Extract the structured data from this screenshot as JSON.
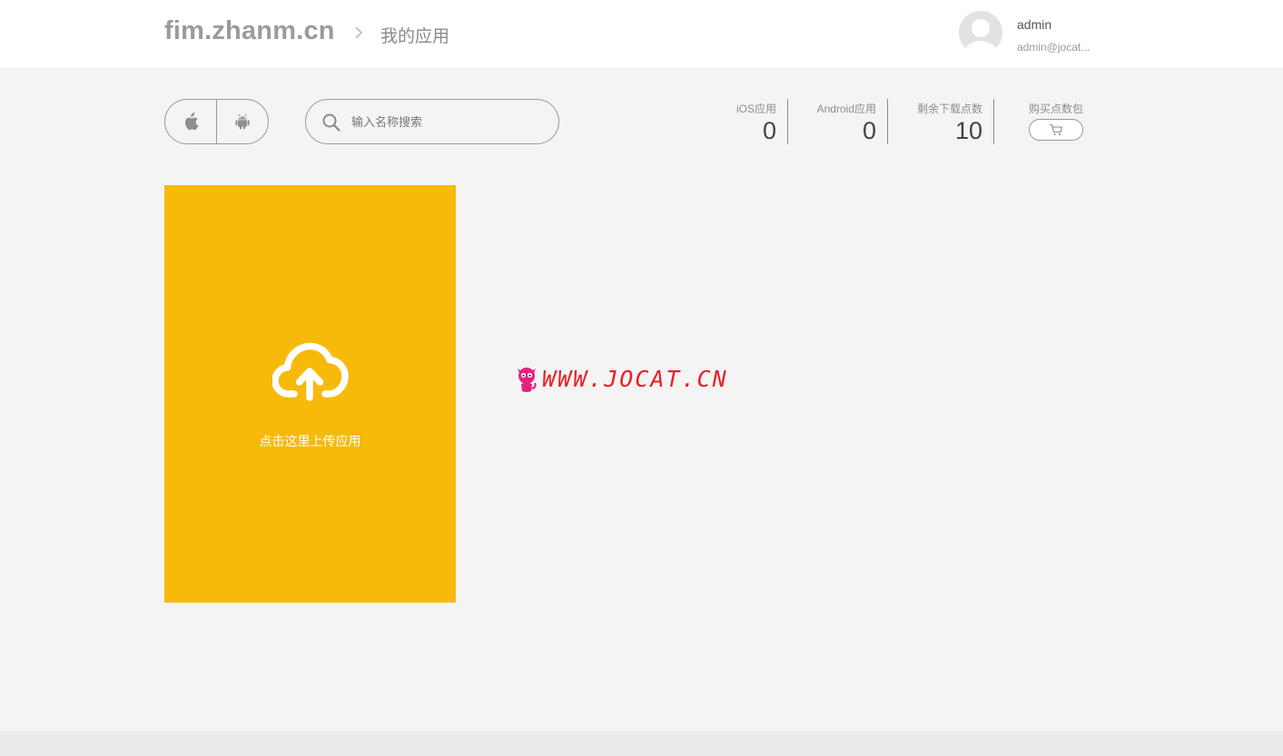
{
  "header": {
    "site_title": "fim.zhanm.cn",
    "breadcrumb": "我的应用",
    "user": {
      "name": "admin",
      "email": "admin@jocat..."
    }
  },
  "filters": {
    "platforms": [
      "apple",
      "android"
    ],
    "search_placeholder": "输入名称搜索"
  },
  "stats": {
    "ios": {
      "label": "iOS应用",
      "value": "0"
    },
    "android": {
      "label": "Android应用",
      "value": "0"
    },
    "downloads": {
      "label": "剩余下载点数",
      "value": "10"
    },
    "buy": {
      "label": "购买点数包"
    }
  },
  "upload": {
    "label": "点击这里上传应用"
  },
  "watermark": {
    "text": "WWW.JOCAT.CN"
  },
  "colors": {
    "accent": "#f7ba0b",
    "watermark_red": "#e8202a",
    "cat_pink": "#e2237c"
  }
}
